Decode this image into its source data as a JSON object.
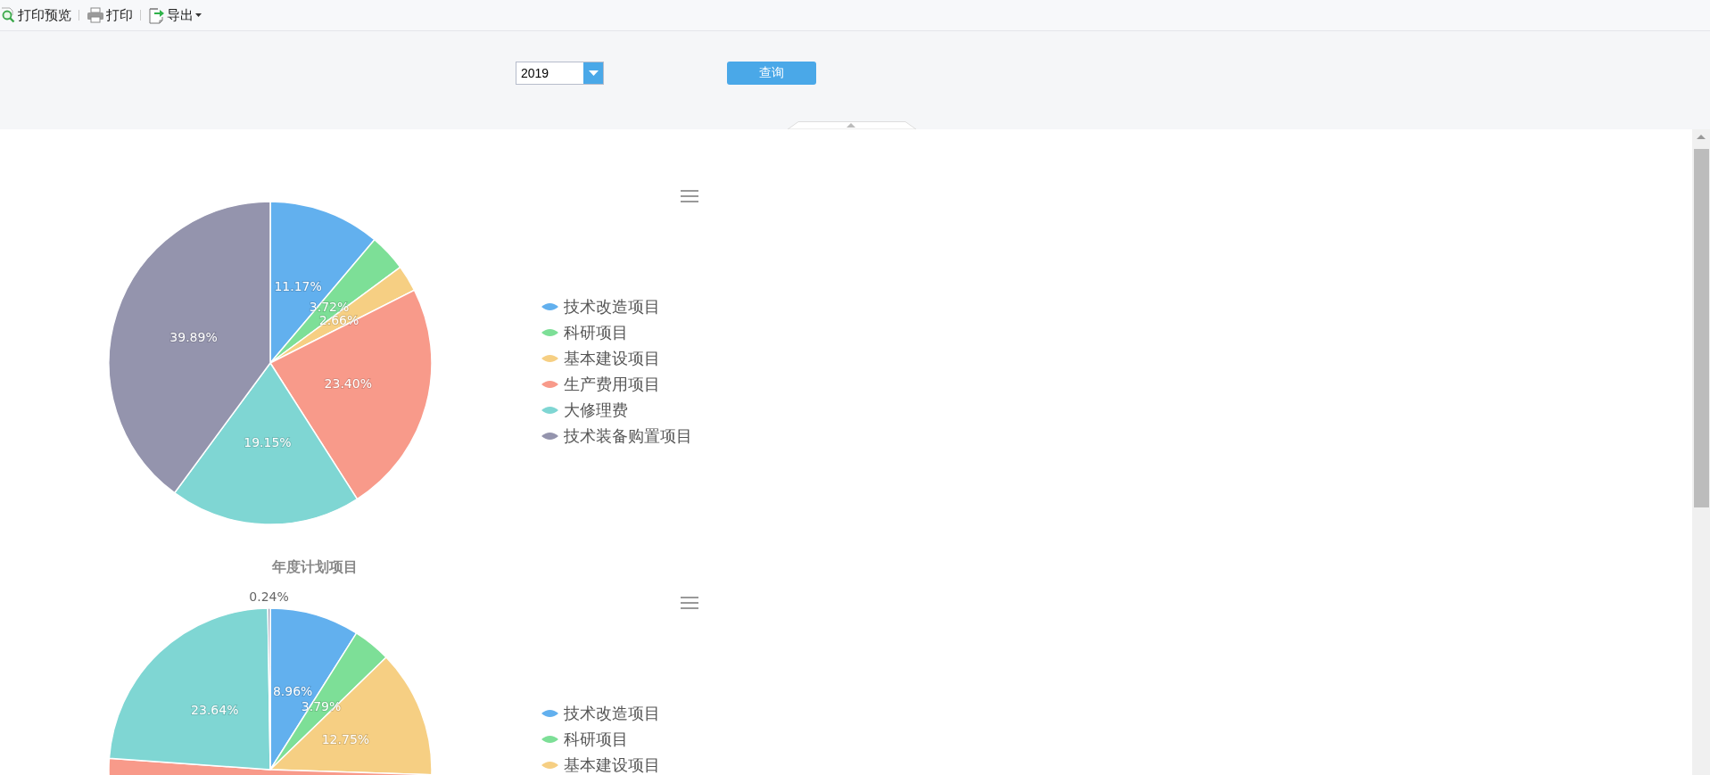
{
  "toolbar": [
    {
      "kind": "preview",
      "label": "打印预览",
      "dropdown": false
    },
    {
      "kind": "print",
      "label": "打印",
      "dropdown": false
    },
    {
      "kind": "export",
      "label": "导出",
      "dropdown": true
    }
  ],
  "query": {
    "year": "2019",
    "button": "查询"
  },
  "charts": [
    {
      "title": "年度计划项目",
      "legend": [
        {
          "label": "技术改造项目",
          "color": "#62b0ee"
        },
        {
          "label": "科研项目",
          "color": "#7ddf97"
        },
        {
          "label": "基本建设项目",
          "color": "#f6cf83"
        },
        {
          "label": "生产费用项目",
          "color": "#f89a8a"
        },
        {
          "label": "大修理费",
          "color": "#7fd6d3"
        },
        {
          "label": "技术装备购置项目",
          "color": "#9494ad"
        }
      ],
      "chart_data": {
        "type": "pie",
        "values": [
          11.17,
          3.72,
          2.66,
          23.4,
          19.15,
          39.89
        ],
        "value_labels": [
          "11.17%",
          "3.72%",
          "2.66%",
          "23.40%",
          "19.15%",
          "39.89%"
        ],
        "colors": [
          "#62b0ee",
          "#7ddf97",
          "#f6cf83",
          "#f89a8a",
          "#7fd6d3",
          "#9494ad"
        ]
      }
    },
    {
      "legend": [
        {
          "label": "技术改造项目",
          "color": "#62b0ee"
        },
        {
          "label": "科研项目",
          "color": "#7ddf97"
        },
        {
          "label": "基本建设项目",
          "color": "#f6cf83"
        }
      ],
      "chart_data": {
        "type": "pie",
        "values": [
          8.96,
          3.79,
          12.75,
          50.62,
          23.64,
          0.24
        ],
        "value_labels": [
          "8.96%",
          "3.79%",
          "12.75%",
          null,
          "23.64%",
          "0.24%"
        ],
        "colors": [
          "#62b0ee",
          "#7ddf97",
          "#f6cf83",
          "#f89a8a",
          "#7fd6d3",
          "#9494ad"
        ]
      }
    }
  ]
}
